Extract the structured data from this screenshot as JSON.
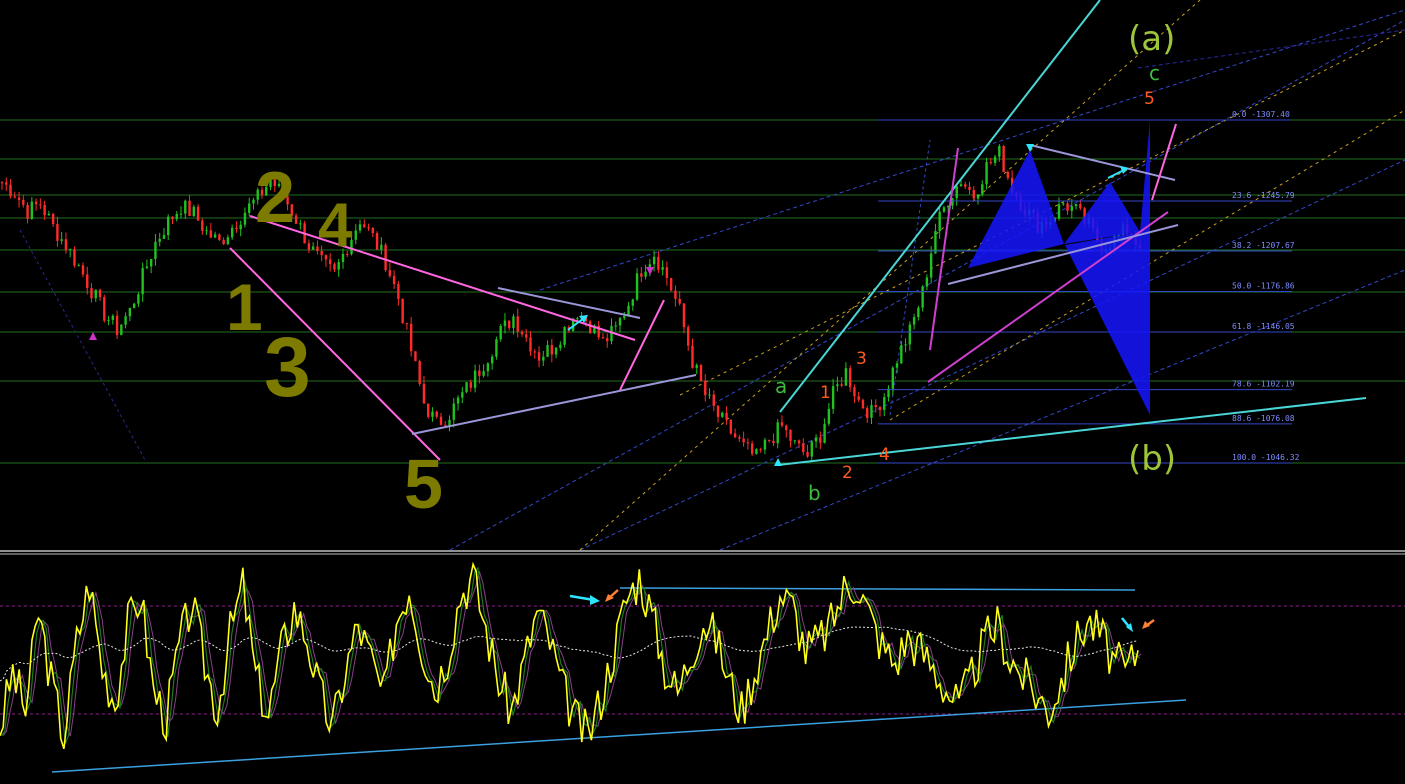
{
  "colors": {
    "background": "#000000",
    "bull_candle": "#1fc21f",
    "bear_candle": "#ff2b2b",
    "fib_line": "#3348c8",
    "fib_label": "#7f8cff",
    "grid_green": "#1f6e1f",
    "osc_main": "#ffff1a",
    "osc_signal": "#1c7a1c",
    "osc_signal2": "#8a3f8a",
    "osc_avg": "#e8e8e8",
    "osc_level": "#8b1f8b",
    "hand_label": "#7d7a00",
    "wave_green": "#3dbb3d",
    "wave_orange": "#ff5a1f",
    "label_green_big": "#9ec53a",
    "cyan_line": "#49d6d6",
    "magenta_line": "#ff66e0",
    "lavender_line": "#9a96d8",
    "triangle_blue": "#1515ff"
  },
  "price_panel": {
    "fib_levels": [
      {
        "label": "0.0 -1307.40",
        "price": 1307.4
      },
      {
        "label": "23.6 -1245.79",
        "price": 1245.79
      },
      {
        "label": "38.2 -1207.67",
        "price": 1207.67
      },
      {
        "label": "50.0 -1176.86",
        "price": 1176.86
      },
      {
        "label": "61.8 -1146.05",
        "price": 1146.05
      },
      {
        "label": "78.6 -1102.19",
        "price": 1102.19
      },
      {
        "label": "88.6 -1076.08",
        "price": 1076.08
      },
      {
        "label": "100.0 -1046.32",
        "price": 1046.32
      }
    ],
    "handwritten_labels": [
      "2",
      "4",
      "1",
      "3",
      "5"
    ],
    "wave_labels_green": [
      "a",
      "b",
      "c"
    ],
    "wave_labels_orange": [
      "1",
      "2",
      "3",
      "4",
      "5"
    ],
    "big_labels": [
      "(a)",
      "(b)"
    ]
  },
  "oscillator_panel": {
    "upper_level_label": "",
    "lower_level_label": ""
  },
  "chart_data": {
    "type": "line",
    "title": "",
    "xlabel": "",
    "ylabel": "",
    "ylim": [
      1000,
      1360
    ],
    "fib_retracement": [
      {
        "level": 0.0,
        "price": 1307.4
      },
      {
        "level": 23.6,
        "price": 1245.79
      },
      {
        "level": 38.2,
        "price": 1207.67
      },
      {
        "level": 50.0,
        "price": 1176.86
      },
      {
        "level": 61.8,
        "price": 1146.05
      },
      {
        "level": 78.6,
        "price": 1102.19
      },
      {
        "level": 88.6,
        "price": 1076.08
      },
      {
        "level": 100.0,
        "price": 1046.32
      }
    ],
    "series": [
      {
        "name": "",
        "values": [
          1260,
          1252,
          1238,
          1244,
          1226,
          1212,
          1196,
          1178,
          1160,
          1148,
          1162,
          1188,
          1214,
          1230,
          1242,
          1236,
          1222,
          1214,
          1226,
          1238,
          1248,
          1262,
          1250,
          1232,
          1212,
          1198,
          1190,
          1212,
          1232,
          1218,
          1200,
          1172,
          1132,
          1092,
          1076,
          1084,
          1098,
          1112,
          1128,
          1146,
          1158,
          1142,
          1128,
          1134,
          1148,
          1162,
          1152,
          1138,
          1148,
          1168,
          1194,
          1206,
          1188,
          1162,
          1124,
          1098,
          1082,
          1070,
          1058,
          1050,
          1064,
          1074,
          1060,
          1052,
          1068,
          1098,
          1116,
          1094,
          1084,
          1098,
          1126,
          1146,
          1176,
          1224,
          1248,
          1262,
          1250,
          1272,
          1282,
          1256,
          1240,
          1228,
          1232,
          1244,
          1238,
          1226,
          1212,
          1216,
          1224,
          1210
        ]
      },
      {
        "name": "",
        "values": [
          22,
          48,
          30,
          76,
          44,
          18,
          62,
          90,
          50,
          34,
          70,
          84,
          40,
          26,
          60,
          80,
          52,
          30,
          66,
          88,
          46,
          28,
          58,
          78,
          64,
          38,
          22,
          48,
          70,
          54,
          36,
          72,
          88,
          60,
          40,
          56,
          84,
          92,
          68,
          44,
          30,
          52,
          76,
          62,
          40,
          26,
          18,
          36,
          58,
          82,
          92,
          74,
          50,
          38,
          56,
          72,
          64,
          44,
          30,
          48,
          66,
          84,
          78,
          58,
          62,
          70,
          86,
          90,
          74,
          60,
          52,
          64,
          58,
          50,
          40,
          32,
          46,
          62,
          70,
          54,
          46,
          38,
          30,
          44,
          60,
          72,
          66,
          54,
          48,
          58
        ]
      }
    ]
  }
}
